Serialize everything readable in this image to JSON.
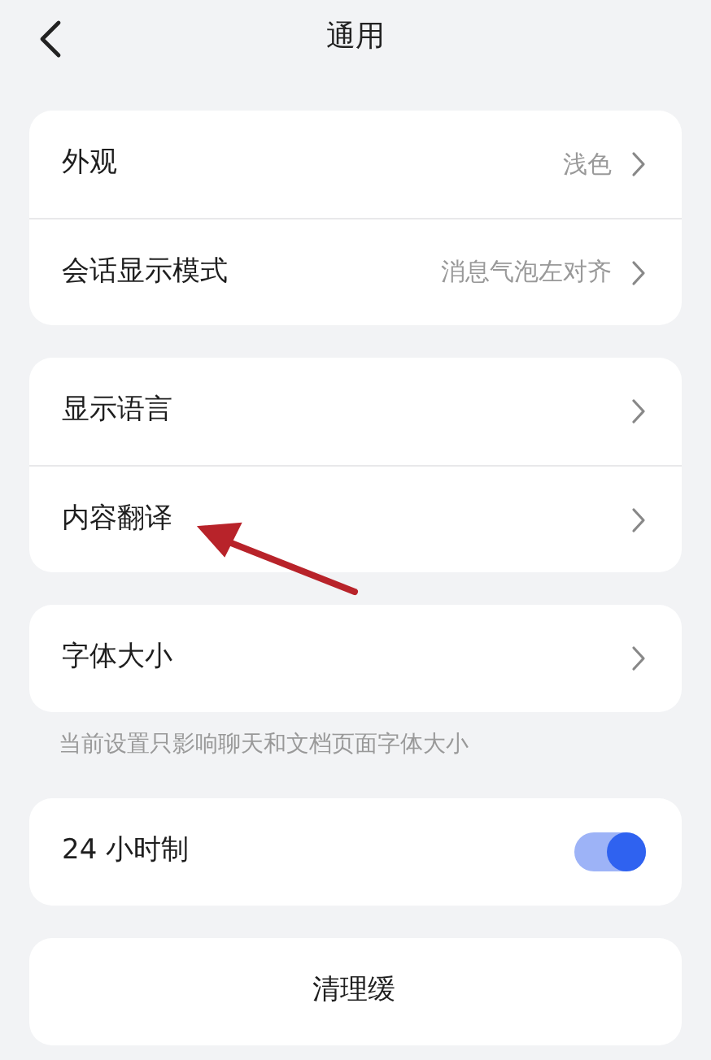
{
  "header": {
    "title": "通用"
  },
  "groups": [
    {
      "rows": [
        {
          "kind": "nav",
          "label": "外观",
          "value": "浅色"
        },
        {
          "kind": "nav",
          "label": "会话显示模式",
          "value": "消息气泡左对齐"
        }
      ]
    },
    {
      "rows": [
        {
          "kind": "nav",
          "label": "显示语言"
        },
        {
          "kind": "nav",
          "label": "内容翻译"
        }
      ]
    },
    {
      "rows": [
        {
          "kind": "nav",
          "label": "字体大小"
        }
      ],
      "note": "当前设置只影响聊天和文档页面字体大小"
    },
    {
      "rows": [
        {
          "kind": "toggle",
          "label": "24 小时制",
          "on": true
        }
      ]
    },
    {
      "rows": [
        {
          "kind": "action",
          "label": "清理缓"
        }
      ]
    }
  ],
  "annotation": {
    "kind": "arrow",
    "color": "#b8232a"
  }
}
